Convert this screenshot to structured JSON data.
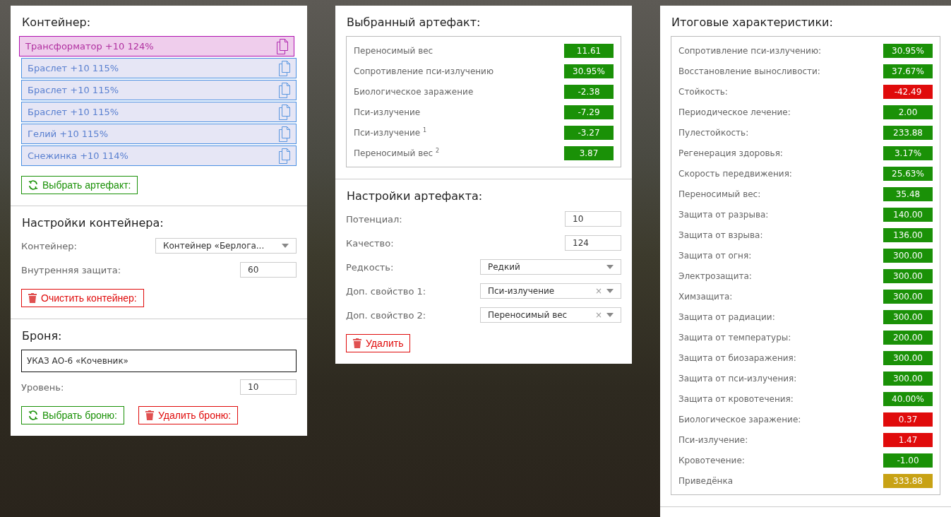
{
  "container": {
    "title": "Контейнер:",
    "items": [
      {
        "label": "Трансформатор +10 124%",
        "selected": true
      },
      {
        "label": "Браслет +10 115%",
        "selected": false
      },
      {
        "label": "Браслет +10 115%",
        "selected": false
      },
      {
        "label": "Браслет +10 115%",
        "selected": false
      },
      {
        "label": "Гелий +10 115%",
        "selected": false
      },
      {
        "label": "Снежинка +10 114%",
        "selected": false
      }
    ],
    "select_button": "Выбрать артефакт:"
  },
  "container_settings": {
    "title": "Настройки контейнера:",
    "fields": [
      {
        "kind": "select",
        "label": "Контейнер:",
        "value": "Контейнер «Берлога..."
      },
      {
        "kind": "input",
        "label": "Внутренняя защита:",
        "value": "60"
      }
    ],
    "clear_button": "Очистить контейнер:"
  },
  "armor": {
    "title": "Броня:",
    "name": "УКАЗ АО-6 «Кочевник»",
    "level_label": "Уровень:",
    "level_value": "10",
    "select_button": "Выбрать броню:",
    "delete_button": "Удалить броню:"
  },
  "selected_artifact": {
    "title": "Выбранный артефакт:",
    "stats": [
      {
        "label": "Переносимый вес",
        "value": "11.61",
        "color": "#1a9107"
      },
      {
        "label": "Сопротивление пси-излучению",
        "value": "30.95%",
        "color": "#1a9107"
      },
      {
        "label": "Биологическое заражение",
        "value": "-2.38",
        "color": "#1a9107"
      },
      {
        "label": "Пси-излучение",
        "value": "-7.29",
        "color": "#1a9107"
      },
      {
        "label": "Пси-излучение $^{1}$",
        "value": "-3.27",
        "color": "#1a9107"
      },
      {
        "label": "Переносимый вес $^{2}$",
        "value": "3.87",
        "color": "#1a9107"
      }
    ]
  },
  "artifact_settings": {
    "title": "Настройки артефакта:",
    "fields": [
      {
        "kind": "input",
        "label": "Потенциал:",
        "value": "10"
      },
      {
        "kind": "input",
        "label": "Качество:",
        "value": "124"
      },
      {
        "kind": "select",
        "label": "Редкость:",
        "value": "Редкий"
      },
      {
        "kind": "clearable",
        "label": "Доп. свойство 1:",
        "value": "Пси-излучение",
        "clear": "×"
      },
      {
        "kind": "clearable",
        "label": "Доп. свойство 2:",
        "value": "Переносимый вес",
        "clear": "×"
      }
    ],
    "delete_button": "Удалить"
  },
  "totals": {
    "title": "Итоговые характеристики:",
    "stats": [
      {
        "label": "Сопротивление пси-излучению:",
        "value": "30.95%",
        "color": "#1a9107"
      },
      {
        "label": "Восстановление выносливости:",
        "value": "37.67%",
        "color": "#1a9107"
      },
      {
        "label": "Стойкость:",
        "value": "-42.49",
        "color": "#e00b0b"
      },
      {
        "label": "Периодическое лечение:",
        "value": "2.00",
        "color": "#1a9107"
      },
      {
        "label": "Пулестойкость:",
        "value": "233.88",
        "color": "#1a9107"
      },
      {
        "label": "Регенерация здоровья:",
        "value": "3.17%",
        "color": "#1a9107"
      },
      {
        "label": "Скорость передвижения:",
        "value": "25.63%",
        "color": "#1a9107"
      },
      {
        "label": "Переносимый вес:",
        "value": "35.48",
        "color": "#1a9107"
      },
      {
        "label": "Защита от разрыва:",
        "value": "140.00",
        "color": "#1a9107"
      },
      {
        "label": "Защита от взрыва:",
        "value": "136.00",
        "color": "#1a9107"
      },
      {
        "label": "Защита от огня:",
        "value": "300.00",
        "color": "#1a9107"
      },
      {
        "label": "Электрозащита:",
        "value": "300.00",
        "color": "#1a9107"
      },
      {
        "label": "Химзащита:",
        "value": "300.00",
        "color": "#1a9107"
      },
      {
        "label": "Защита от радиации:",
        "value": "300.00",
        "color": "#1a9107"
      },
      {
        "label": "Защита от температуры:",
        "value": "200.00",
        "color": "#1a9107"
      },
      {
        "label": "Защита от биозаражения:",
        "value": "300.00",
        "color": "#1a9107"
      },
      {
        "label": "Защита от пси-излучения:",
        "value": "300.00",
        "color": "#1a9107"
      },
      {
        "label": "Защита от кровотечения:",
        "value": "40.00%",
        "color": "#1a9107"
      },
      {
        "label": "Биологическое заражение:",
        "value": "0.37",
        "color": "#e00b0b"
      },
      {
        "label": "Пси-излучение:",
        "value": "1.47",
        "color": "#e00b0b"
      },
      {
        "label": "Кровотечение:",
        "value": "-1.00",
        "color": "#1a9107"
      },
      {
        "label": "Приведёнка",
        "value": "333.88",
        "color": "#c8a214"
      }
    ]
  }
}
